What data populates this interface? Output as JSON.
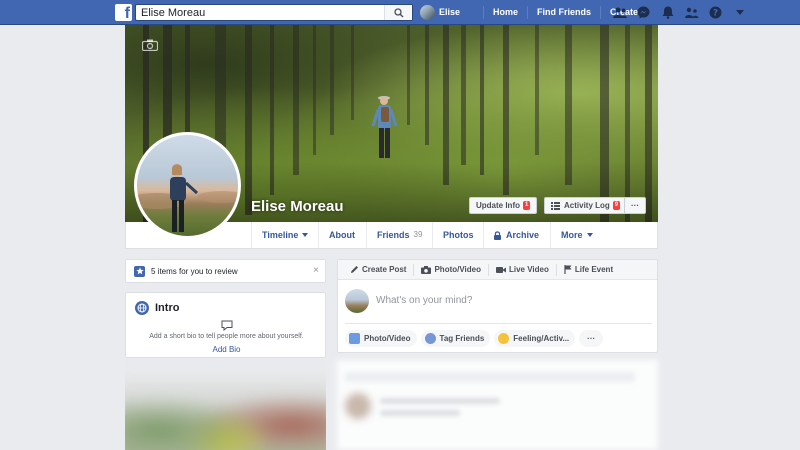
{
  "topbar": {
    "logo": "f",
    "search_value": "Elise Moreau",
    "user_name": "Elise",
    "links": [
      "Home",
      "Find Friends",
      "Create"
    ],
    "icons": [
      "friend-requests-icon",
      "messenger-icon",
      "notifications-icon",
      "groups-icon",
      "help-icon",
      "account-menu-icon"
    ]
  },
  "profile": {
    "name": "Elise Moreau",
    "update_info_label": "Update Info",
    "update_info_badge": "1",
    "activity_log_label": "Activity Log",
    "activity_log_badge": "9",
    "more_dots": "···"
  },
  "tabs": {
    "timeline": "Timeline",
    "about": "About",
    "friends": "Friends",
    "friends_count": "39",
    "photos": "Photos",
    "archive": "Archive",
    "more": "More"
  },
  "review": {
    "text": "5 items for you to review",
    "close": "×"
  },
  "intro": {
    "title": "Intro",
    "bio_prompt": "Add a short bio to tell people more about yourself.",
    "add_bio": "Add Bio"
  },
  "composer": {
    "tabs": [
      "Create Post",
      "Photo/Video",
      "Live Video",
      "Life Event"
    ],
    "prompt": "What's on your mind?",
    "pills": [
      "Photo/Video",
      "Tag Friends",
      "Feeling/Activ...",
      "···"
    ]
  },
  "colors": {
    "brand": "#4267b2",
    "link": "#365899",
    "background": "#e9ebee",
    "badge": "#fa3e3e"
  }
}
